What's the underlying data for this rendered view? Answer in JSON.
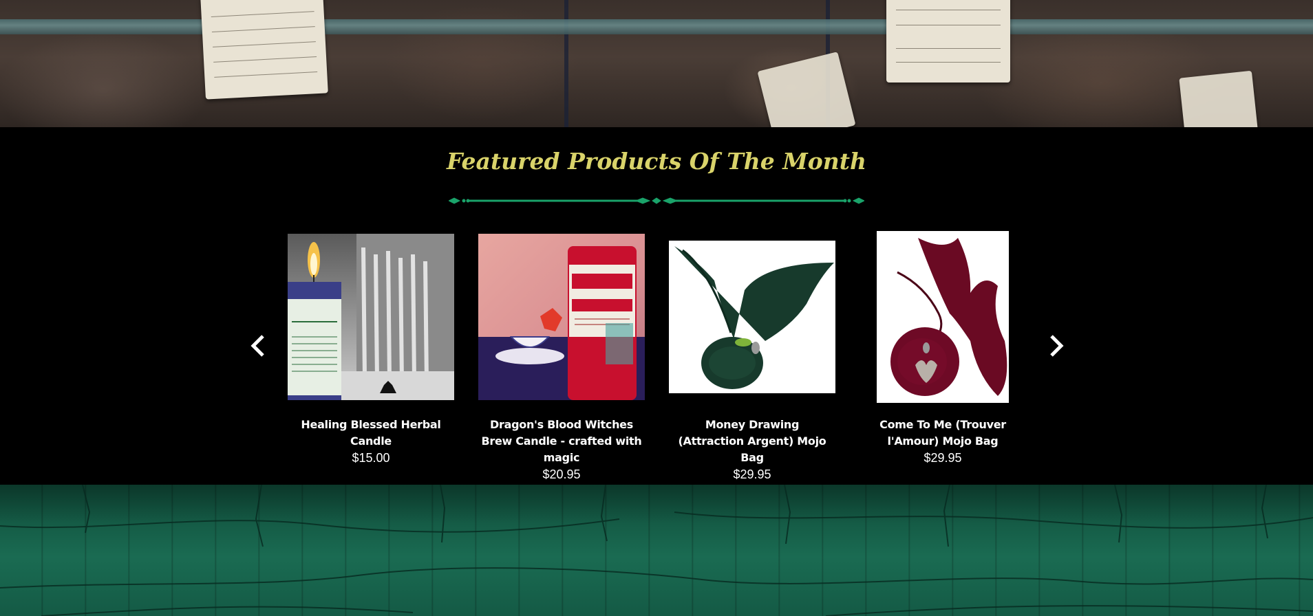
{
  "section": {
    "title": "Featured Products Of The Month"
  },
  "carousel": {
    "prev_icon": "chevron-left-icon",
    "next_icon": "chevron-right-icon"
  },
  "products": [
    {
      "name": "Healing Blessed Herbal Candle",
      "price": "$15.00"
    },
    {
      "name": "Dragon's Blood Witches Brew Candle - crafted with magic",
      "price": "$20.95"
    },
    {
      "name": "Money Drawing (Attraction Argent) Mojo Bag",
      "price": "$29.95"
    },
    {
      "name": "Come To Me (Trouver l'Amour) Mojo Bag",
      "price": "$29.95"
    }
  ],
  "colors": {
    "title": "#d9d36a",
    "divider": "#1aa36a",
    "section_bg": "#000000",
    "footer_green": "#1a6b52"
  }
}
